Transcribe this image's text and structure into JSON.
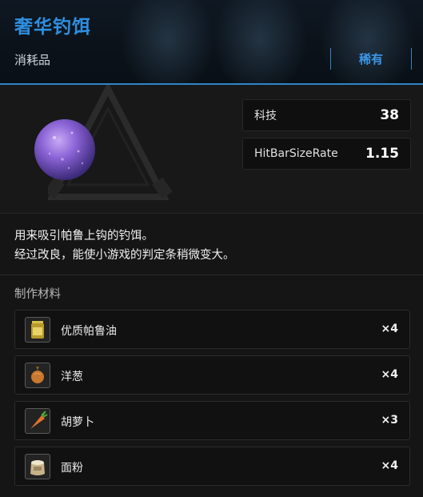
{
  "header": {
    "title": "奢华钓饵",
    "category": "消耗品",
    "rarity": "稀有"
  },
  "item": {
    "icon": "purple-orb-bait-icon",
    "stats": [
      {
        "label": "科技",
        "value": "38"
      },
      {
        "label": "HitBarSizeRate",
        "value": "1.15"
      }
    ]
  },
  "description": {
    "line1": "用来吸引帕鲁上钩的钓饵。",
    "line2": "经过改良，能使小游戏的判定条稍微变大。"
  },
  "materials": {
    "heading": "制作材料",
    "items": [
      {
        "name": "优质帕鲁油",
        "qty": "×4",
        "icon": "oil-jar-icon"
      },
      {
        "name": "洋葱",
        "qty": "×4",
        "icon": "onion-icon"
      },
      {
        "name": "胡萝卜",
        "qty": "×3",
        "icon": "carrot-icon"
      },
      {
        "name": "面粉",
        "qty": "×4",
        "icon": "flour-sack-icon"
      }
    ]
  },
  "colors": {
    "accent": "#2f8fe0",
    "background": "#151515",
    "orb": "#8a63d6"
  }
}
